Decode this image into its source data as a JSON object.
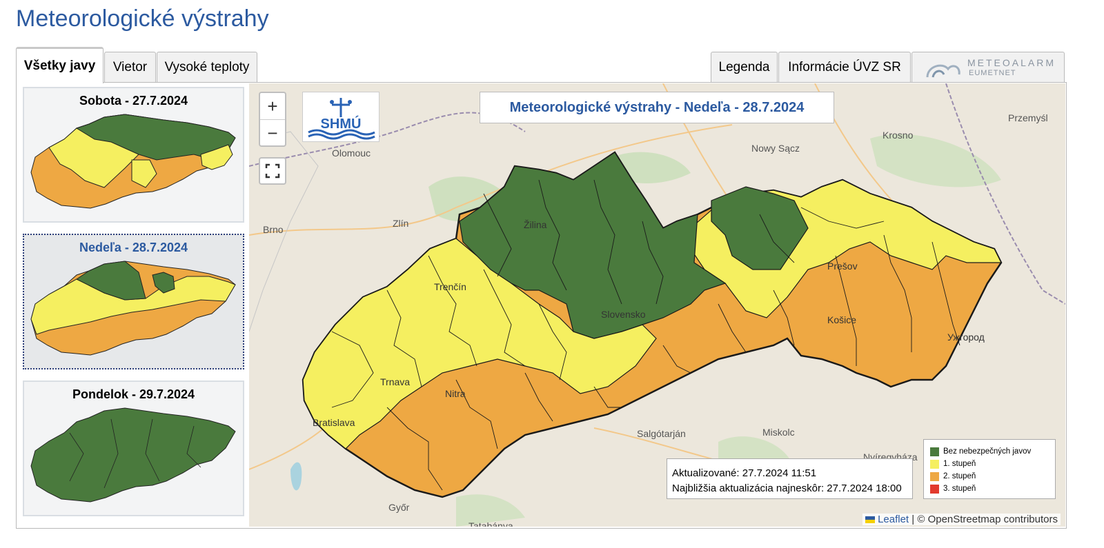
{
  "page_title": "Meteorologické výstrahy",
  "tabs": [
    {
      "label": "Všetky javy",
      "active": true
    },
    {
      "label": "Vietor",
      "active": false
    },
    {
      "label": "Vysoké teploty",
      "active": false
    }
  ],
  "right_tabs": {
    "legend": "Legenda",
    "info": "Informácie ÚVZ SR",
    "meteoalarm": "METEOALARM",
    "meteoalarm_sub": "EUMETNET"
  },
  "days": [
    {
      "title": "Sobota - 27.7.2024",
      "selected": false
    },
    {
      "title": "Nedeľa - 28.7.2024",
      "selected": true
    },
    {
      "title": "Pondelok - 29.7.2024",
      "selected": false
    }
  ],
  "map": {
    "title": "Meteorologické výstrahy - Nedeľa - 28.7.2024",
    "logo_text": "SHMÚ",
    "zoom_in": "+",
    "zoom_out": "−",
    "places": [
      "Olomouc",
      "Nowy Sącz",
      "Krosno",
      "Przemyśl",
      "Brno",
      "Zlín",
      "Žilina",
      "Trenčín",
      "Slovensko",
      "Prešov",
      "Košice",
      "Ужгород",
      "Trnava",
      "Nitra",
      "Bratislava",
      "Salgótarján",
      "Miskolc",
      "Nyíregyháza",
      "Győr",
      "Tatabánya"
    ],
    "updated": "Aktualizované: 27.7.2024 11:51",
    "next_update": "Najbližšia aktualizácia najneskôr: 27.7.2024 18:00",
    "attribution_leaflet": "Leaflet",
    "attribution_osm": "| © OpenStreetmap contributors"
  },
  "legend": [
    {
      "label": "Bez nebezpečných javov",
      "color": "#4a7a3d"
    },
    {
      "label": "1. stupeň",
      "color": "#f5ef60"
    },
    {
      "label": "2. stupeň",
      "color": "#eea843"
    },
    {
      "label": "3. stupeň",
      "color": "#e23a2d"
    }
  ],
  "colors": {
    "green": "#4a7a3d",
    "yellow": "#f5ef60",
    "orange": "#eea843",
    "red": "#e23a2d",
    "accent": "#2c5aa0"
  }
}
